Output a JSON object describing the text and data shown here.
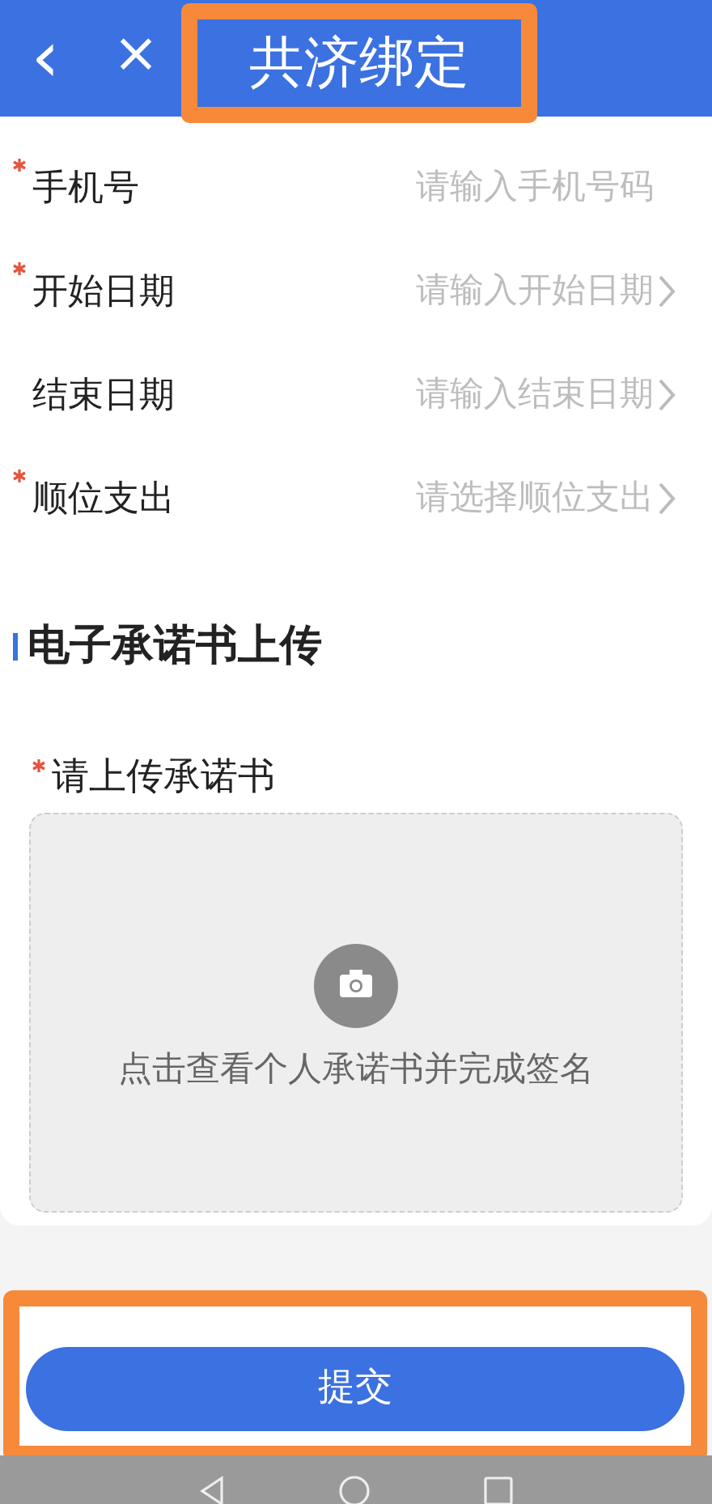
{
  "header": {
    "back": "‹",
    "close": "×",
    "title": "共济绑定",
    "highlighted": true
  },
  "fields": [
    {
      "kind": "input",
      "label": "手机号",
      "required": true,
      "placeholder": "请输入手机号码"
    },
    {
      "kind": "select",
      "label": "开始日期",
      "required": true,
      "placeholder": "请输入开始日期"
    },
    {
      "kind": "select",
      "label": "结束日期",
      "required": false,
      "placeholder": "请输入结束日期"
    },
    {
      "kind": "select",
      "label": "顺位支出",
      "required": true,
      "placeholder": "请选择顺位支出"
    }
  ],
  "section": {
    "title": "电子承诺书上传",
    "upload_label": "请上传承诺书",
    "required": true,
    "upload_hint": "点击查看个人承诺书并完成签名"
  },
  "submit": {
    "label": "提交",
    "highlighted": true
  }
}
